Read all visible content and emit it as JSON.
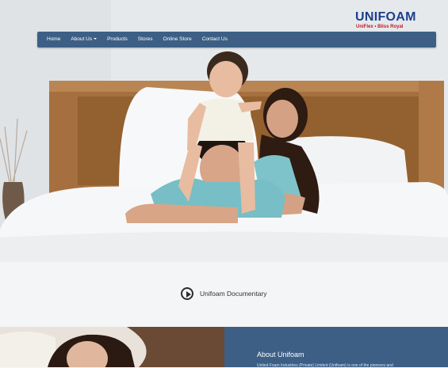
{
  "brand": {
    "logo_text": "UNIFOAM",
    "logo_subtext": "UniFlex • Bliss Royal"
  },
  "nav": {
    "items": [
      {
        "label": "Home"
      },
      {
        "label": "About Us",
        "has_dropdown": true
      },
      {
        "label": "Products"
      },
      {
        "label": "Stores"
      },
      {
        "label": "Online Store"
      },
      {
        "label": "Contact Us"
      }
    ]
  },
  "hero": {
    "image": "family-on-bed-photo"
  },
  "documentary": {
    "label": "Unifoam Documentary",
    "icon": "play-circle-icon"
  },
  "about": {
    "title": "About Unifoam",
    "text": "United Foam Industries (Private) Limited (Unifoam) is one of the pioneers and"
  },
  "colors": {
    "nav_bg": "#3d5f85",
    "about_bg": "#3d5f85",
    "logo_blue": "#1c3f8c",
    "logo_red": "#c0192a"
  }
}
